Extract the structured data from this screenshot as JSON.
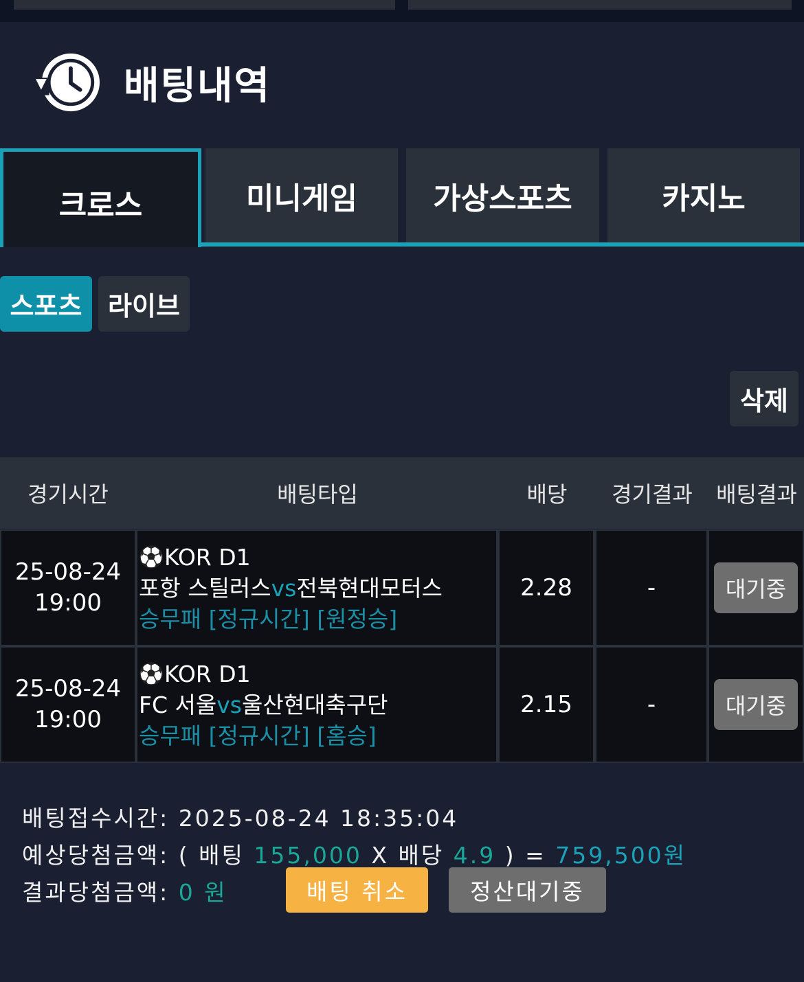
{
  "header": {
    "title": "배팅내역",
    "icon": "history-clock-icon"
  },
  "tabs": [
    {
      "label": "크로스",
      "active": true
    },
    {
      "label": "미니게임",
      "active": false
    },
    {
      "label": "가상스포츠",
      "active": false
    },
    {
      "label": "카지노",
      "active": false
    }
  ],
  "subtabs": [
    {
      "label": "스포츠",
      "active": true
    },
    {
      "label": "라이브",
      "active": false
    }
  ],
  "delete_label": "삭제",
  "table": {
    "headers": [
      "경기시간",
      "배팅타입",
      "배당",
      "경기결과",
      "배팅결과"
    ],
    "rows": [
      {
        "date": "25-08-24",
        "time": "19:00",
        "league": "KOR D1",
        "home": "포항 스틸러스",
        "vs": "vs",
        "away": "전북현대모터스",
        "pick": "승무패 [정규시간] [원정승]",
        "odds": "2.28",
        "result": "-",
        "status": "대기중"
      },
      {
        "date": "25-08-24",
        "time": "19:00",
        "league": "KOR D1",
        "home": "FC 서울",
        "vs": "vs",
        "away": "울산현대축구단",
        "pick": "승무패 [정규시간] [홈승]",
        "odds": "2.15",
        "result": "-",
        "status": "대기중"
      }
    ]
  },
  "summary": {
    "accept_label": "배팅접수시간:",
    "accept_time": "2025-08-24 18:35:04",
    "expected_label": "예상당첨금액:",
    "paren_open": "(",
    "bet_label": "배팅",
    "bet_amount": "155,000",
    "times": "X",
    "odds_label": "배당",
    "odds_value": "4.9",
    "paren_close": ")",
    "equals": "=",
    "expected_amount": "759,500원",
    "result_label": "결과당첨금액:",
    "result_amount": "0",
    "result_unit": "원",
    "cancel_label": "배팅 취소",
    "pending_label": "정산대기중"
  },
  "colors": {
    "background": "#1a1f31",
    "accent": "#1aa2b8",
    "cancel": "#f7b244",
    "pending": "#6e6e6e"
  }
}
